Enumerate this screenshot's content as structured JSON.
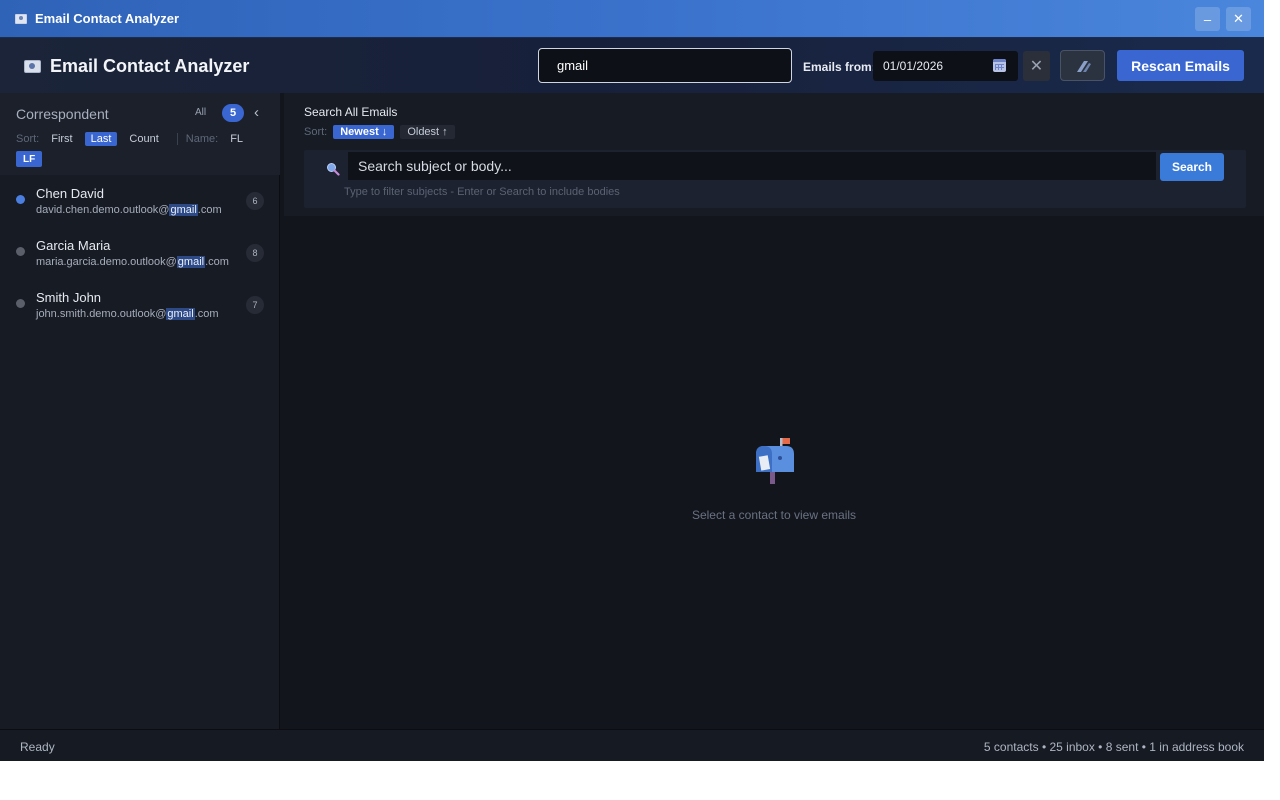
{
  "window": {
    "title": "Email Contact Analyzer",
    "minimize": "–",
    "close": "✕"
  },
  "header": {
    "title": "Email Contact Analyzer",
    "search_value": "gmail",
    "emails_from_label": "Emails from:",
    "date_value": "01/01/2026",
    "clear_label": "✕",
    "rescan_label": "Rescan Emails"
  },
  "sidebar": {
    "label": "Correspondent",
    "all_label": "All",
    "count": "5",
    "collapse": "‹",
    "sort_label": "Sort:",
    "sort_first": "First",
    "sort_last": "Last",
    "sort_count": "Count",
    "name_label": "Name:",
    "name_fl": "FL",
    "name_lf": "LF",
    "contacts": [
      {
        "name": "Chen David",
        "email_pre": "david.chen.demo.outlook@",
        "email_hl": "gmail",
        "email_post": ".com",
        "count": "6",
        "active": true
      },
      {
        "name": "Garcia Maria",
        "email_pre": "maria.garcia.demo.outlook@",
        "email_hl": "gmail",
        "email_post": ".com",
        "count": "8",
        "active": false
      },
      {
        "name": "Smith John",
        "email_pre": "john.smith.demo.outlook@",
        "email_hl": "gmail",
        "email_post": ".com",
        "count": "7",
        "active": false
      }
    ]
  },
  "main": {
    "search_title": "Search All Emails",
    "sort_label": "Sort:",
    "sort_newest": "Newest ↓",
    "sort_oldest": "Oldest ↑",
    "search_placeholder": "Search subject or body...",
    "search_button": "Search",
    "search_hint": "Type to filter subjects - Enter or Search to include bodies",
    "empty_text": "Select a contact to view emails"
  },
  "status": {
    "left": "Ready",
    "right": "5 contacts • 25 inbox • 8 sent • 1 in address book"
  },
  "colors": {
    "accent": "#3a66d1",
    "background": "#12151c"
  }
}
